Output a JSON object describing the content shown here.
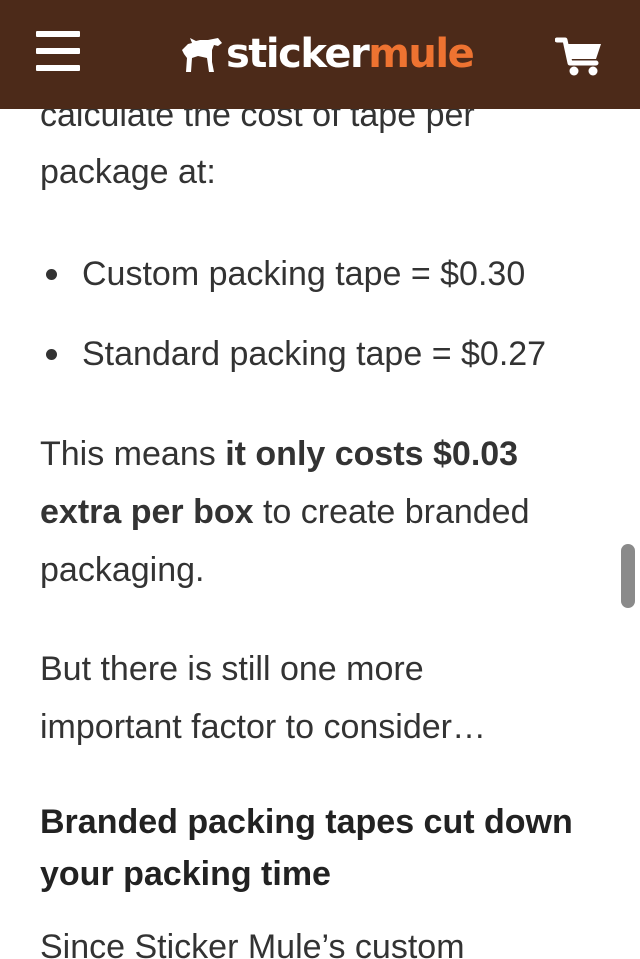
{
  "header": {
    "brand_part1": "sticker",
    "brand_part2": "mule",
    "menu_icon": "hamburger-menu-icon",
    "cart_icon": "shopping-cart-icon",
    "logo_icon": "mule-icon",
    "background_color": "#4c2a19",
    "accent_color": "#ee7331"
  },
  "article": {
    "cut_line": "calculate the cost of tape per",
    "intro_line": "package at:",
    "bullets": [
      "Custom packing tape = $0.30",
      "Standard packing tape = $0.27"
    ],
    "para1": {
      "pre": "This means ",
      "bold": "it only costs $0.03 extra per box",
      "post": " to create branded packaging."
    },
    "para2": "But there is still one more important factor to consider…",
    "heading": "Branded packing tapes cut down your packing time",
    "cut_bottom": "Since Sticker Mule’s custom"
  }
}
